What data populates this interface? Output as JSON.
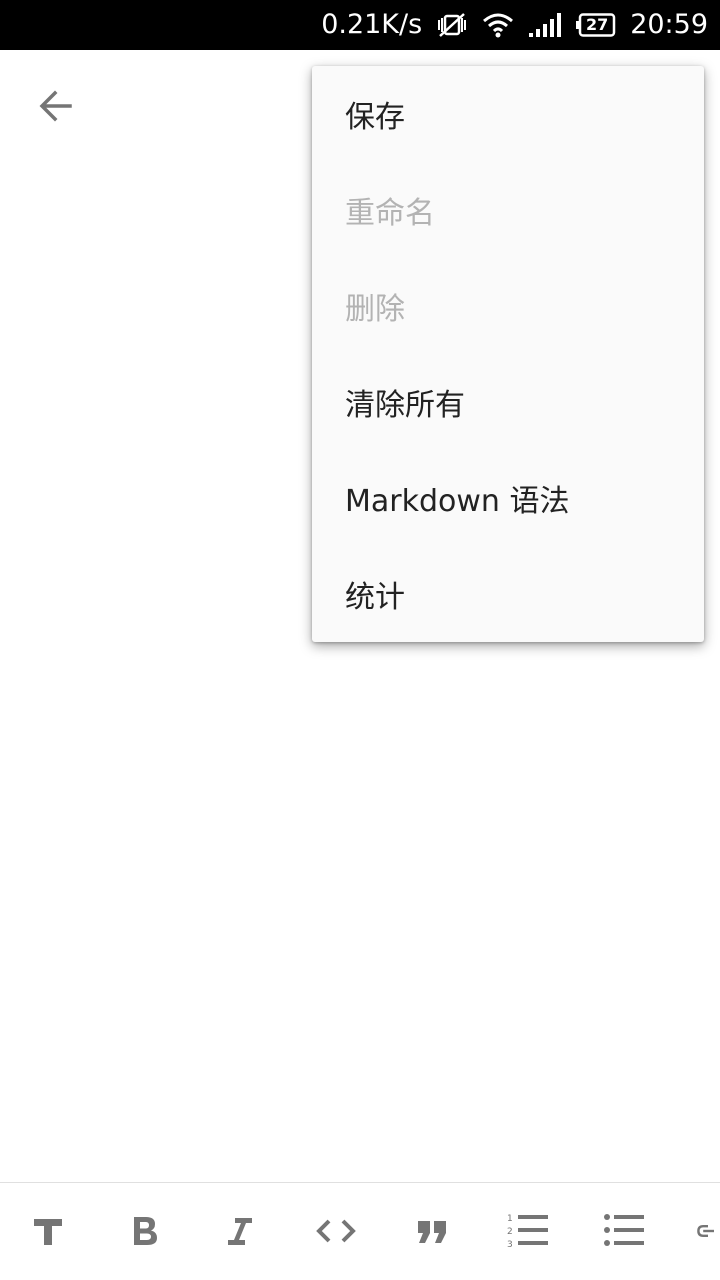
{
  "status_bar": {
    "net_speed": "0.21K/s",
    "battery_level": "27",
    "time": "20:59",
    "icons": [
      "vibrate-off-icon",
      "wifi-icon",
      "signal-icon",
      "battery-icon"
    ]
  },
  "toolbar": {
    "back_icon": "arrow-back-icon"
  },
  "menu": {
    "items": [
      {
        "label": "保存",
        "enabled": true
      },
      {
        "label": "重命名",
        "enabled": false
      },
      {
        "label": "删除",
        "enabled": false
      },
      {
        "label": "清除所有",
        "enabled": true
      },
      {
        "label": "Markdown 语法",
        "enabled": true
      },
      {
        "label": "统计",
        "enabled": true
      }
    ]
  },
  "format_bar": {
    "icons": [
      "header-icon",
      "bold-icon",
      "italic-icon",
      "code-icon",
      "quote-icon",
      "ordered-list-icon",
      "bullet-list-icon",
      "link-icon"
    ]
  },
  "colors": {
    "status_bar_bg": "#000000",
    "menu_bg": "#fafafa",
    "icon_gray": "#757575",
    "text_primary": "#222222",
    "text_disabled": "#b3b3b3"
  }
}
